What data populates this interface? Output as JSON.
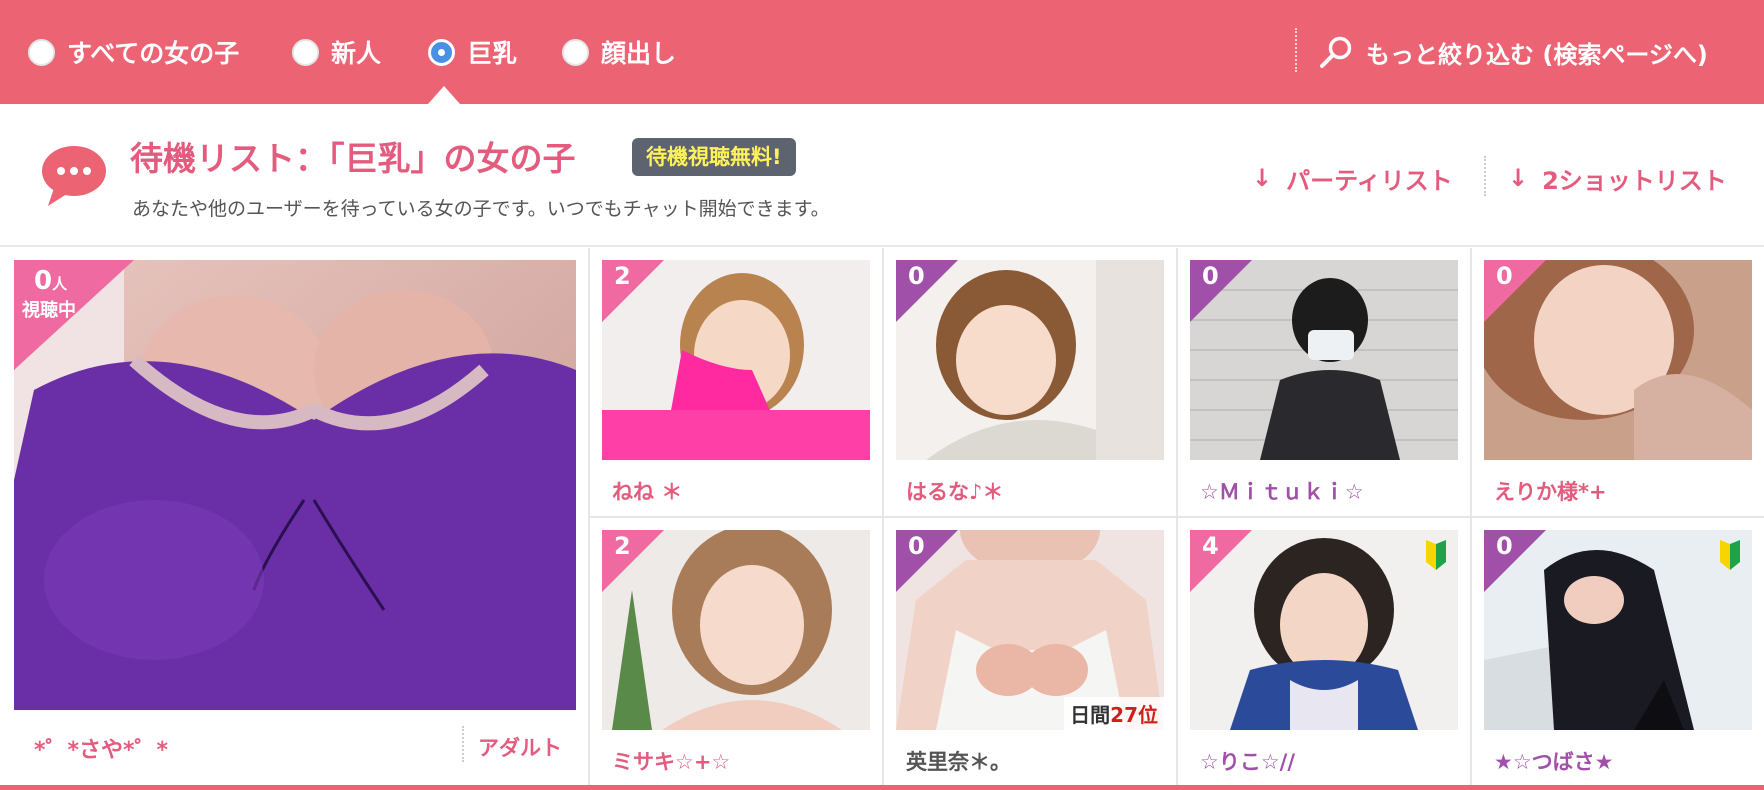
{
  "filters": [
    {
      "label": "すべての女の子",
      "checked": false
    },
    {
      "label": "新人",
      "checked": false
    },
    {
      "label": "巨乳",
      "checked": true
    },
    {
      "label": "顔出し",
      "checked": false
    }
  ],
  "search_link": {
    "label": "もっと絞り込む (検索ページへ)",
    "icon": "search-icon"
  },
  "header": {
    "title": "待機リスト：「巨乳」の女の子",
    "badge": "待機視聴無料!",
    "subtitle": "あなたや他のユーザーを待っている女の子です。いつでもチャット開始できます。",
    "links": [
      {
        "arrow": "↓",
        "label": "パーティリスト"
      },
      {
        "arrow": "↓",
        "label": "2ショットリスト"
      }
    ]
  },
  "featured": {
    "viewers": "0",
    "viewers_unit": "人",
    "viewers_label": "視聴中",
    "name": "*゜*さや*゜*",
    "category": "アダルト"
  },
  "performers": [
    {
      "count": "2",
      "name": "ねね ＊",
      "new": false
    },
    {
      "count": "0",
      "name": "はるな♪＊",
      "new": false
    },
    {
      "count": "0",
      "name": "☆Ｍｉｔｕｋｉ☆",
      "new": false
    },
    {
      "count": "0",
      "name": "えりか様*+",
      "new": false
    },
    {
      "count": "2",
      "name": "ミサキ☆+☆",
      "new": false
    },
    {
      "count": "0",
      "name": "英里奈＊。",
      "new": false,
      "rank_label": "日間",
      "rank_value": "27位"
    },
    {
      "count": "4",
      "name": "☆りこ☆//",
      "new": true
    },
    {
      "count": "0",
      "name": "★☆つばさ★",
      "new": true
    }
  ],
  "colors": {
    "brand_pink": "#ec6474",
    "name_pink": "#e35c7e",
    "name_purple": "#a050a8",
    "badge_pink": "#ee6aa0",
    "badge_purple": "#a050a8",
    "free_badge_bg": "#5d6470",
    "free_badge_text": "#fff15a"
  }
}
